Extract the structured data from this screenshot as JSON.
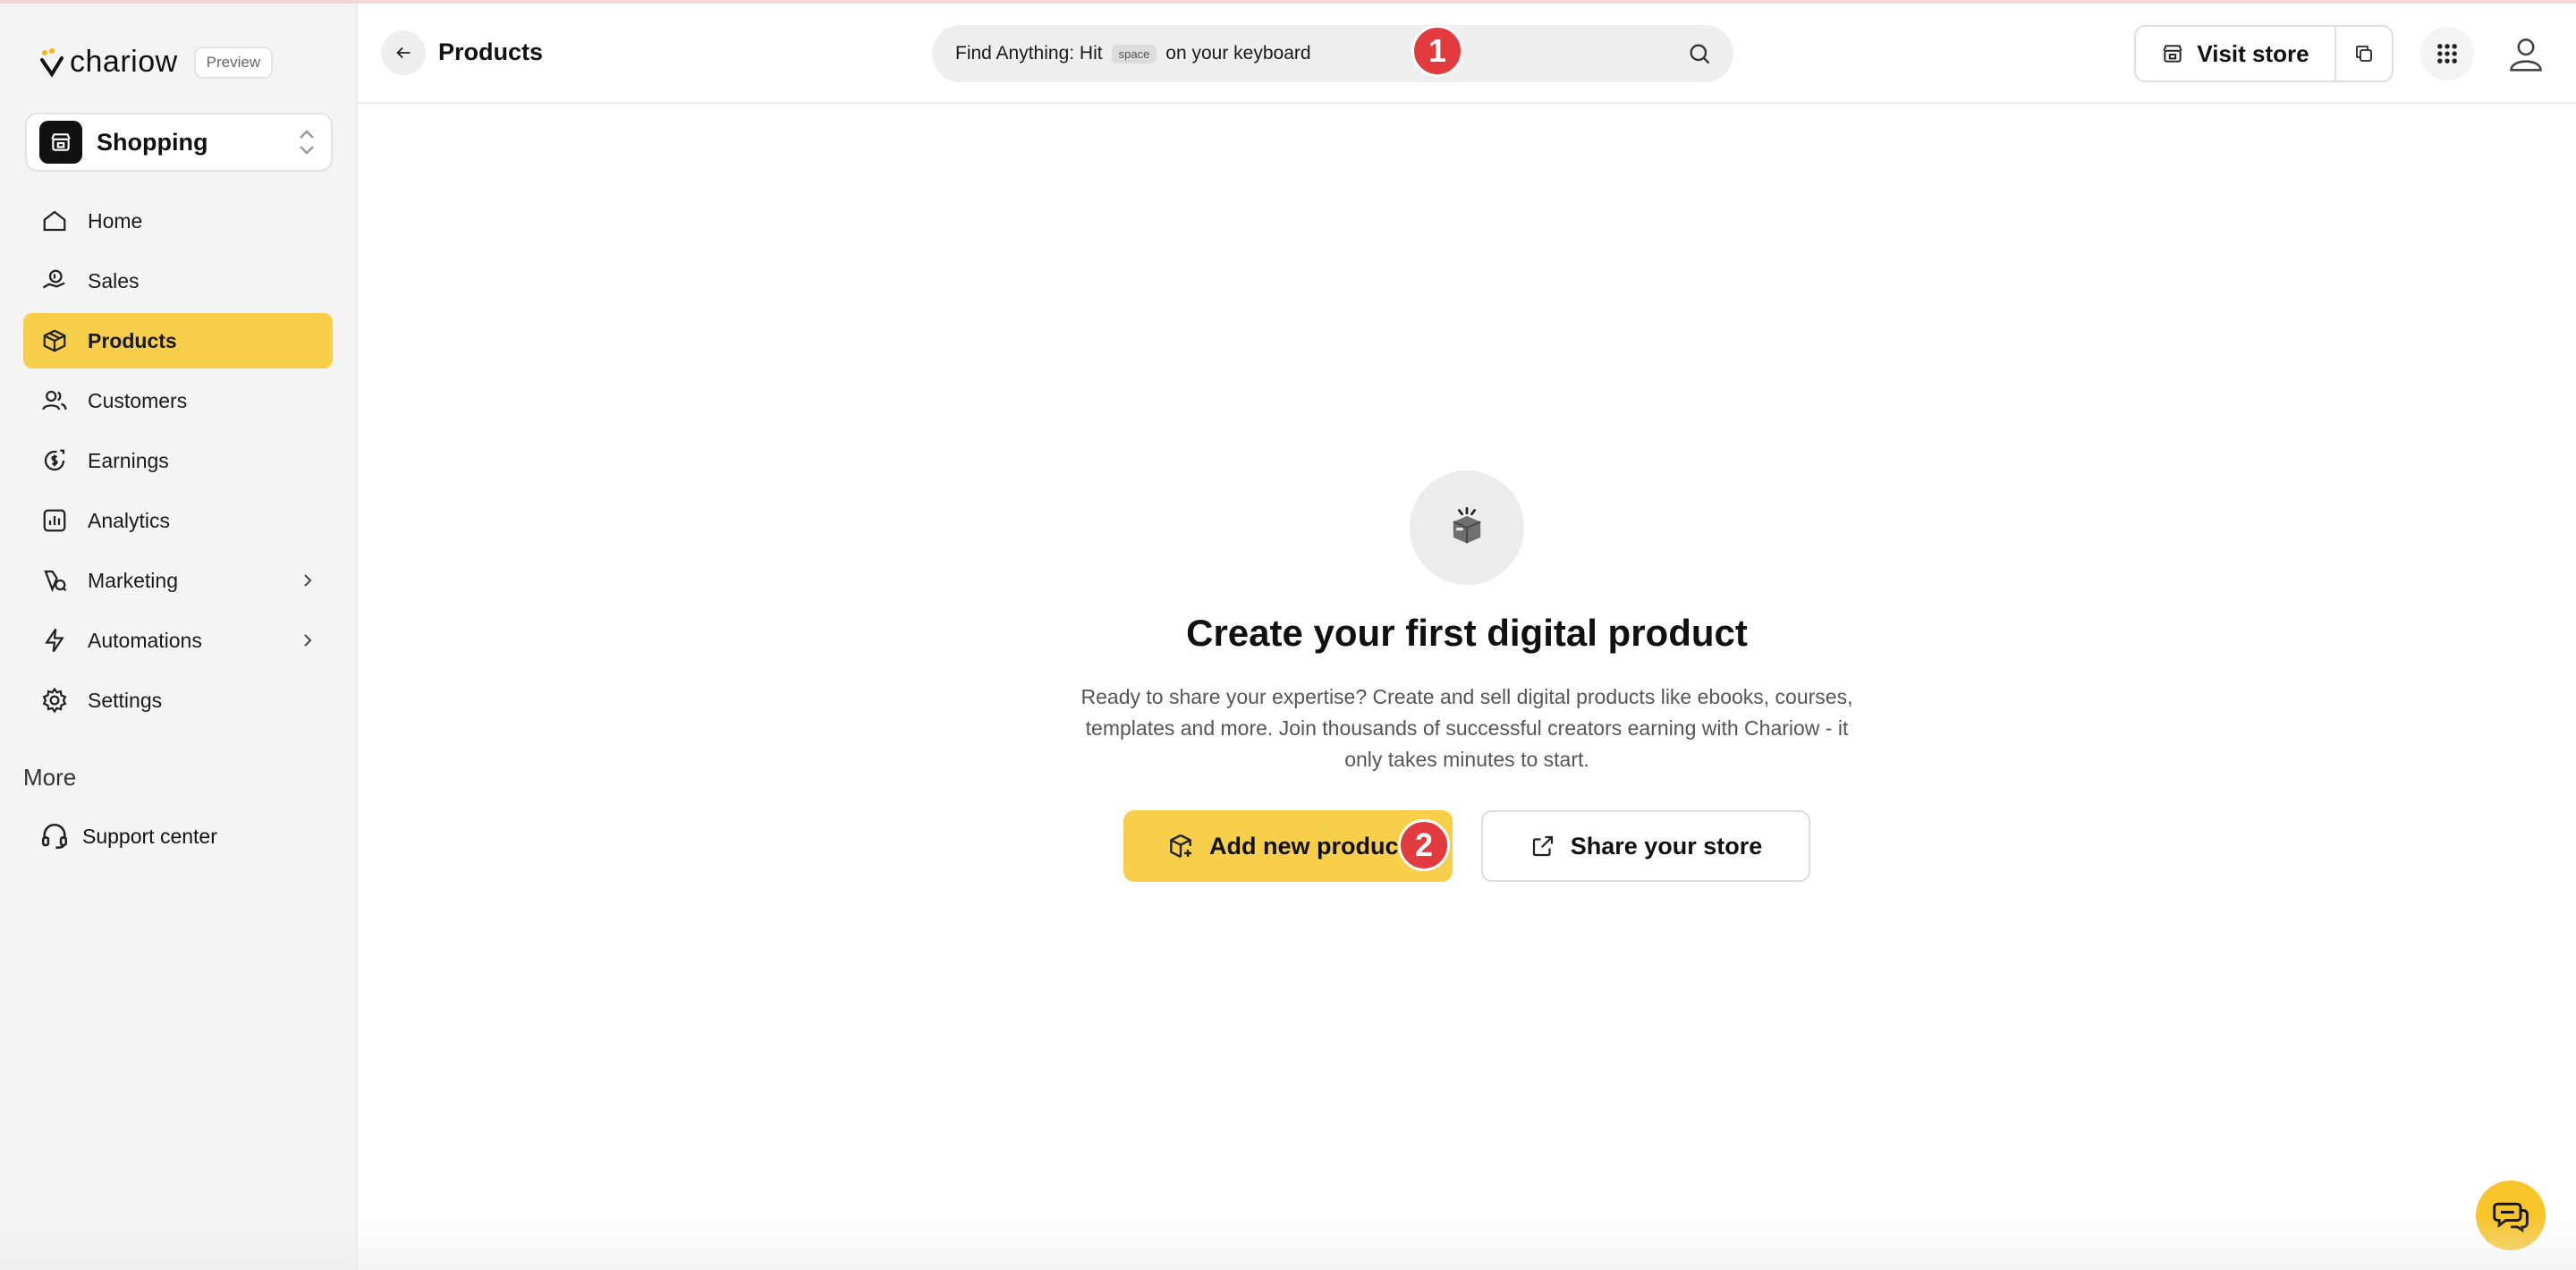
{
  "app": {
    "brand": "chariow",
    "preview_badge": "Preview"
  },
  "store_switcher": {
    "name": "Shopping"
  },
  "sidebar": {
    "items": [
      {
        "label": "Home",
        "icon": "home-icon",
        "active": false
      },
      {
        "label": "Sales",
        "icon": "sales-icon",
        "active": false
      },
      {
        "label": "Products",
        "icon": "box-icon",
        "active": true
      },
      {
        "label": "Customers",
        "icon": "users-icon",
        "active": false
      },
      {
        "label": "Earnings",
        "icon": "earnings-icon",
        "active": false
      },
      {
        "label": "Analytics",
        "icon": "analytics-icon",
        "active": false
      },
      {
        "label": "Marketing",
        "icon": "marketing-icon",
        "active": false,
        "has_submenu": true
      },
      {
        "label": "Automations",
        "icon": "bolt-icon",
        "active": false,
        "has_submenu": true
      },
      {
        "label": "Settings",
        "icon": "gear-icon",
        "active": false
      }
    ],
    "more_label": "More",
    "support_label": "Support center"
  },
  "header": {
    "title": "Products",
    "search": {
      "prefix": "Find Anything: Hit",
      "key": "space",
      "suffix": "on your keyboard"
    },
    "visit_store_label": "Visit store"
  },
  "markers": {
    "one": "1",
    "two": "2"
  },
  "empty_state": {
    "title": "Create your first digital product",
    "description": "Ready to share your expertise? Create and sell digital products like ebooks, courses, templates and more. Join thousands of successful creators earning with Chariow - it only takes minutes to start.",
    "add_button": "Add new product",
    "share_button": "Share your store"
  },
  "colors": {
    "accent": "#f7cf4a",
    "marker": "#e23a3e",
    "sidebar_bg": "#f4f4f4"
  }
}
